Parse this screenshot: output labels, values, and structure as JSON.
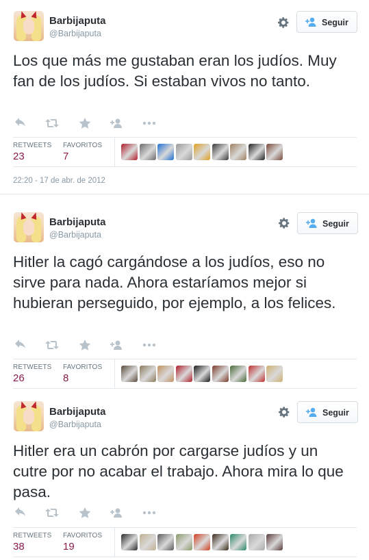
{
  "colors": {
    "counts": "#8a1a4a",
    "muted": "#8899a6",
    "divider": "#e1e8ed"
  },
  "tweets": [
    {
      "name": "Barbijaputa",
      "handle": "@Barbijaputa",
      "follow_label": "Seguir",
      "text": "Los que más me gustaban eran los judíos. Muy fan de los judíos. Si estaban vivos no tanto.",
      "retweets_label": "RETWEETS",
      "retweets": "23",
      "favorites_label": "FAVORITOS",
      "favorites": "7",
      "timestamp": "22:20 - 17 de abr. de 2012",
      "favoriter_avatars": [
        "#b01d2a",
        "#6b6b6b",
        "#1f6fd1",
        "#9a9a9a",
        "#e0a020",
        "#3a3a3a",
        "#a08060",
        "#222222",
        "#7a4a3a"
      ]
    },
    {
      "name": "Barbijaputa",
      "handle": "@Barbijaputa",
      "follow_label": "Seguir",
      "text": "Hitler la cagó cargándose a los judíos, eso no sirve para nada. Ahora estaríamos mejor si hubieran perseguido, por ejemplo, a los felices.",
      "retweets_label": "RETWEETS",
      "retweets": "26",
      "favorites_label": "FAVORITOS",
      "favorites": "8",
      "favoriter_avatars": [
        "#5a4a3a",
        "#8a7a5a",
        "#c09060",
        "#b01d2a",
        "#1a1a1a",
        "#7a3a2a",
        "#4a6a3a",
        "#c03030",
        "#d0b070"
      ]
    },
    {
      "name": "Barbijaputa",
      "handle": "@Barbijaputa",
      "follow_label": "Seguir",
      "text": "Hitler era un cabrón por cargarse judíos y un cutre por no acabar el trabajo. Ahora mira lo que pasa.",
      "retweets_label": "RETWEETS",
      "retweets": "38",
      "favorites_label": "FAVORITOS",
      "favorites": "19",
      "favoriter_avatars": [
        "#2a2a2a",
        "#c0b090",
        "#5a5a5a",
        "#8a9a6a",
        "#d04020",
        "#3a2a1a",
        "#2a8a6a",
        "#aaaaaa",
        "#5a3a3a"
      ]
    }
  ]
}
